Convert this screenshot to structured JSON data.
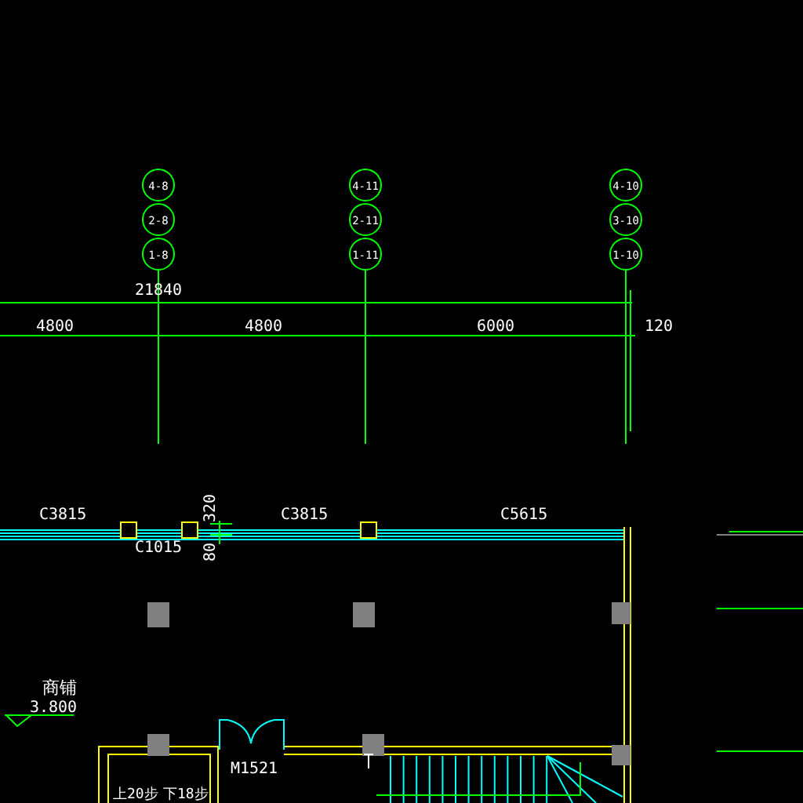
{
  "axis_bubbles": [
    {
      "labels": [
        "4-8",
        "2-8",
        "1-8"
      ]
    },
    {
      "labels": [
        "4-11",
        "2-11",
        "1-11"
      ]
    },
    {
      "labels": [
        "4-10",
        "3-10",
        "1-10"
      ]
    }
  ],
  "dimensions": {
    "total": "21840",
    "segments": [
      "4800",
      "4800",
      "6000",
      "120"
    ]
  },
  "windows": [
    "C3815",
    "C1015",
    "C3815",
    "C5615"
  ],
  "wall_dims": [
    "320",
    "80"
  ],
  "room_label": "商铺",
  "elevation": "3.800",
  "door": "M1521",
  "stair_notes": [
    "上20步",
    "下18步"
  ]
}
